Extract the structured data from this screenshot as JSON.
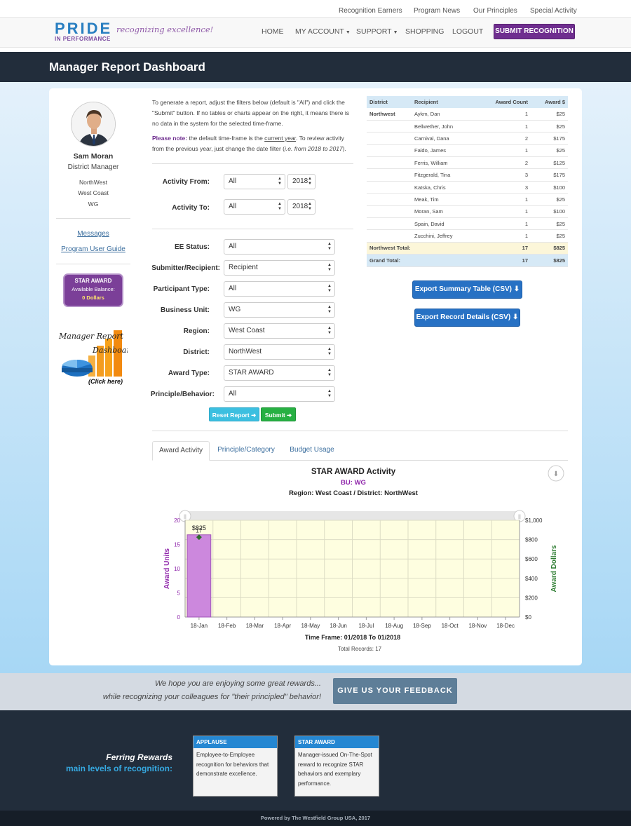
{
  "util_nav": [
    "Recognition Earners",
    "Program News",
    "Our Principles",
    "Special Activity"
  ],
  "brand": {
    "pride": "PRIDE",
    "performance": "IN PERFORMANCE",
    "tagline": "recognizing excellence!"
  },
  "main_nav": {
    "home": "HOME",
    "account": "MY ACCOUNT",
    "support": "SUPPORT",
    "shopping": "SHOPPING",
    "logout": "LOGOUT",
    "submit": "SUBMIT RECOGNITION"
  },
  "page_title": "Manager Report Dashboard",
  "profile": {
    "name": "Sam Moran",
    "role": "District Manager",
    "district": "NorthWest",
    "region": "West Coast",
    "bu": "WG",
    "messages": "Messages",
    "guide": "Program User Guide"
  },
  "star_award": {
    "title": "STAR AWARD",
    "label": "Available Balance:",
    "balance": "0 Dollars"
  },
  "report_graphic": {
    "title_line1": "Manager Report",
    "title_line2": "Dashboard",
    "cta": "(Click here)"
  },
  "intro": {
    "p1": "To generate a report, adjust the filters below (default is \"All\") and click the \"Submit\" button. If no tables or charts appear on the right, it means there is no data in the system for the selected time-frame.",
    "note_label": "Please note:",
    "note_pre": " the default time-frame is the ",
    "note_current": "current year",
    "note_mid": ". To review activity from the previous year, just change the date filter (",
    "note_example": "i.e. from 2018 to 2017",
    "note_end": ")."
  },
  "filters": {
    "activity_from": {
      "label": "Activity From:",
      "month": "All",
      "year": "2018"
    },
    "activity_to": {
      "label": "Activity To:",
      "month": "All",
      "year": "2018"
    },
    "ee_status": {
      "label": "EE Status:",
      "value": "All"
    },
    "submitter": {
      "label": "Submitter/Recipient:",
      "value": "Recipient"
    },
    "participant": {
      "label": "Participant Type:",
      "value": "All"
    },
    "business_unit": {
      "label": "Business Unit:",
      "value": "WG"
    },
    "region": {
      "label": "Region:",
      "value": "West Coast"
    },
    "district": {
      "label": "District:",
      "value": "NorthWest"
    },
    "award_type": {
      "label": "Award Type:",
      "value": "STAR AWARD"
    },
    "principle": {
      "label": "Principle/Behavior:",
      "value": "All"
    },
    "reset": "Reset Report",
    "submit": "Submit"
  },
  "table": {
    "headers": [
      "District",
      "Recipient",
      "Award Count",
      "Award $"
    ],
    "district": "Northwest",
    "rows": [
      [
        "Aykm, Dan",
        "1",
        "$25"
      ],
      [
        "Bellwether, John",
        "1",
        "$25"
      ],
      [
        "Carnival, Dana",
        "2",
        "$175"
      ],
      [
        "Faldo, James",
        "1",
        "$25"
      ],
      [
        "Ferris, William",
        "2",
        "$125"
      ],
      [
        "Fitzgerald, Tina",
        "3",
        "$175"
      ],
      [
        "Katska, Chris",
        "3",
        "$100"
      ],
      [
        "Meak, Tim",
        "1",
        "$25"
      ],
      [
        "Moran, Sam",
        "1",
        "$100"
      ],
      [
        "Spain, David",
        "1",
        "$25"
      ],
      [
        "Zucchini, Jeffrey",
        "1",
        "$25"
      ]
    ],
    "district_total": {
      "label": "Northwest Total:",
      "count": "17",
      "amount": "$825"
    },
    "grand_total": {
      "label": "Grand Total:",
      "count": "17",
      "amount": "$825"
    }
  },
  "exports": {
    "summary": "Export Summary Table (CSV)",
    "details": "Export Record Details (CSV)"
  },
  "tabs": [
    "Award Activity",
    "Principle/Category",
    "Budget Usage"
  ],
  "chart_data": {
    "type": "bar",
    "title": "STAR AWARD Activity",
    "subtitle_bu": "BU: WG",
    "subtitle_region": "Region: West Coast / District: NorthWest",
    "categories": [
      "18-Jan",
      "18-Feb",
      "18-Mar",
      "18-Apr",
      "18-May",
      "18-Jun",
      "18-Jul",
      "18-Aug",
      "18-Sep",
      "18-Oct",
      "18-Nov",
      "18-Dec"
    ],
    "series": [
      {
        "values": [
          17,
          0,
          0,
          0,
          0,
          0,
          0,
          0,
          0,
          0,
          0,
          0
        ],
        "color": "#cc88dd",
        "axis": "left"
      },
      {
        "values": [
          825,
          0,
          0,
          0,
          0,
          0,
          0,
          0,
          0,
          0,
          0,
          0
        ],
        "color": "#2e6b2e",
        "axis": "right"
      }
    ],
    "bar_label": "17",
    "point_label": "$825",
    "ylabel": "Award Units",
    "ylabel_right": "Award Dollars",
    "ylim": [
      0,
      20
    ],
    "ylim_right": [
      0,
      1000
    ],
    "yticks": [
      "0",
      "5",
      "10",
      "15",
      "20"
    ],
    "yticks_right": [
      "$0",
      "$200",
      "$400",
      "$600",
      "$800",
      "$1,000"
    ],
    "xlabel": "Time Frame: 01/2018 To 01/2018",
    "footer": "Total Records: 17",
    "plot_bg": "#fefee0",
    "grid": true
  },
  "feedback": {
    "line1": "We hope you are enjoying some great rewards...",
    "line2": "while recognizing your colleagues for \"their principled\" behavior!",
    "button": "GIVE US YOUR FEEDBACK"
  },
  "footer": {
    "title1": "Ferring Rewards",
    "title2": "main levels of recognition:",
    "levels": [
      {
        "name": "APPLAUSE",
        "desc": "Employee-to-Employee recognition for behaviors that demonstrate excellence."
      },
      {
        "name": "STAR AWARD",
        "desc": "Manager-issued On-The-Spot reward to recognize STAR behaviors and exemplary performance."
      }
    ],
    "copyright": "Powered by The Westfield Group USA, 2017"
  },
  "colors": {
    "brand_purple": "#6f2e8f",
    "header_dark": "#222d3b",
    "export_blue": "#2771c4",
    "feedback_btn": "#5e7e98"
  }
}
